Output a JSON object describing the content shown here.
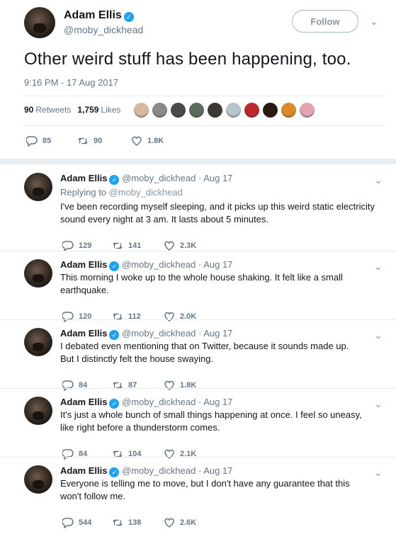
{
  "main_tweet": {
    "name": "Adam Ellis",
    "handle": "@moby_dickhead",
    "follow_label": "Follow",
    "text": "Other weird stuff has been happening, too.",
    "timestamp": "9:16 PM - 17 Aug 2017",
    "retweets_count": "90",
    "retweets_label": "Retweets",
    "likes_count": "1,759",
    "likes_label": "Likes",
    "actions": {
      "replies": "85",
      "retweets": "90",
      "likes": "1.8K"
    },
    "liker_colors": [
      "#d9b8a0",
      "#8a8a8a",
      "#4a4a4a",
      "#5b6b5b",
      "#3d3a35",
      "#b8c4cc",
      "#c0272d",
      "#2a1a12",
      "#d98b2b",
      "#e3a3b3"
    ]
  },
  "replies": [
    {
      "name": "Adam Ellis",
      "handle": "@moby_dickhead",
      "date": "Aug 17",
      "replying_to_label": "Replying to",
      "replying_to_handle": "@moby_dickhead",
      "text_lines": [
        "I've been recording myself sleeping, and it picks up this weird static electricity",
        "sound every night at 3 am. It lasts about 5 minutes."
      ],
      "replies": "129",
      "retweets": "141",
      "likes": "2.3K"
    },
    {
      "name": "Adam Ellis",
      "handle": "@moby_dickhead",
      "date": "Aug 17",
      "text_lines": [
        "This morning I woke up to the whole house shaking. It felt like a small",
        "earthquake."
      ],
      "replies": "120",
      "retweets": "112",
      "likes": "2.0K"
    },
    {
      "name": "Adam Ellis",
      "handle": "@moby_dickhead",
      "date": "Aug 17",
      "text_lines": [
        "I debated even mentioning that on Twitter, because it sounds made up.",
        "But I distinctly felt the house swaying."
      ],
      "replies": "84",
      "retweets": "87",
      "likes": "1.8K"
    },
    {
      "name": "Adam Ellis",
      "handle": "@moby_dickhead",
      "date": "Aug 17",
      "text_lines": [
        "It's just a whole bunch of small things happening at once. I feel so uneasy,",
        "like right before a thunderstorm comes."
      ],
      "replies": "84",
      "retweets": "104",
      "likes": "2.1K"
    },
    {
      "name": "Adam Ellis",
      "handle": "@moby_dickhead",
      "date": "Aug 17",
      "text_lines": [
        "Everyone is telling me to move, but I don't have any guarantee that this",
        "won't follow me."
      ],
      "replies": "544",
      "retweets": "138",
      "likes": "2.6K"
    }
  ],
  "colors": {
    "accent": "#1da1f2",
    "muted": "#657786",
    "divider": "#e6ecf0"
  }
}
